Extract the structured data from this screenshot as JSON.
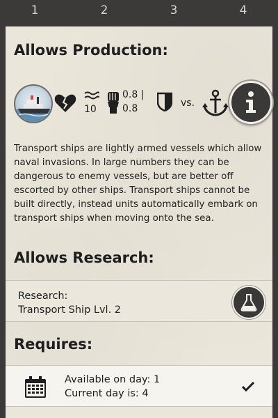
{
  "tabs": [
    {
      "label": "1",
      "active": true
    },
    {
      "label": "2",
      "active": false
    },
    {
      "label": "3",
      "active": false
    },
    {
      "label": "4",
      "active": false
    }
  ],
  "production": {
    "heading": "Allows Production:",
    "unit_icon": "transport-ship-portrait",
    "stats": {
      "health_icon": "broken-heart-icon",
      "speed_icon": "waves-icon",
      "speed_value": "10",
      "strength_icon": "fist-icon",
      "strength_line1": "0.8 |",
      "strength_line2": "0.8",
      "defense_icon": "shield-icon",
      "vs_label": "vs.",
      "vs_target_icon": "anchor-icon"
    },
    "info_icon": "info-icon",
    "description": "Transport ships are lightly armed vessels which allow naval invasions. In large numbers they can be dangerous to enemy vessels, but are better off escorted by other ships. Transport ships cannot be built directly, instead units automatically embark on transport ships when moving onto the sea."
  },
  "research": {
    "heading": "Allows Research:",
    "line1": "Research:",
    "line2": "Transport Ship Lvl. 2",
    "button_icon": "flask-icon"
  },
  "requires": {
    "heading": "Requires:",
    "line1": "Available on day: 1",
    "line2": "Current day is: 4",
    "icon": "calendar-icon",
    "status_icon": "checkmark-icon"
  }
}
